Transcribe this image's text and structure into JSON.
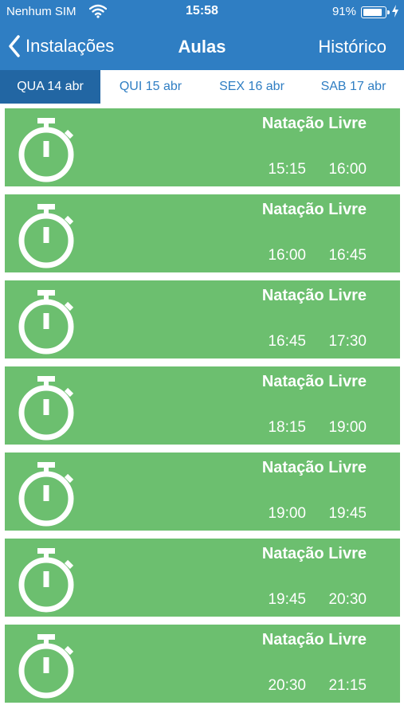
{
  "status_bar": {
    "carrier": "Nenhum SIM",
    "time": "15:58",
    "battery": "91%"
  },
  "nav": {
    "back_label": "Instalações",
    "title": "Aulas",
    "history_label": "Histórico"
  },
  "tabs": [
    {
      "label": "QUA 14 abr",
      "active": true
    },
    {
      "label": "QUI 15 abr",
      "active": false
    },
    {
      "label": "SEX 16 abr",
      "active": false
    },
    {
      "label": "SAB 17 abr",
      "active": false
    }
  ],
  "classes": [
    {
      "title": "Natação Livre",
      "start": "15:15",
      "end": "16:00"
    },
    {
      "title": "Natação Livre",
      "start": "16:00",
      "end": "16:45"
    },
    {
      "title": "Natação Livre",
      "start": "16:45",
      "end": "17:30"
    },
    {
      "title": "Natação Livre",
      "start": "18:15",
      "end": "19:00"
    },
    {
      "title": "Natação Livre",
      "start": "19:00",
      "end": "19:45"
    },
    {
      "title": "Natação Livre",
      "start": "19:45",
      "end": "20:30"
    },
    {
      "title": "Natação Livre",
      "start": "20:30",
      "end": "21:15"
    }
  ],
  "colors": {
    "header": "#2f7ec3",
    "active_tab": "#2266a3",
    "card": "#6cbf6f"
  },
  "icons": {
    "card": "stopwatch-icon",
    "back": "chevron-left-icon"
  }
}
